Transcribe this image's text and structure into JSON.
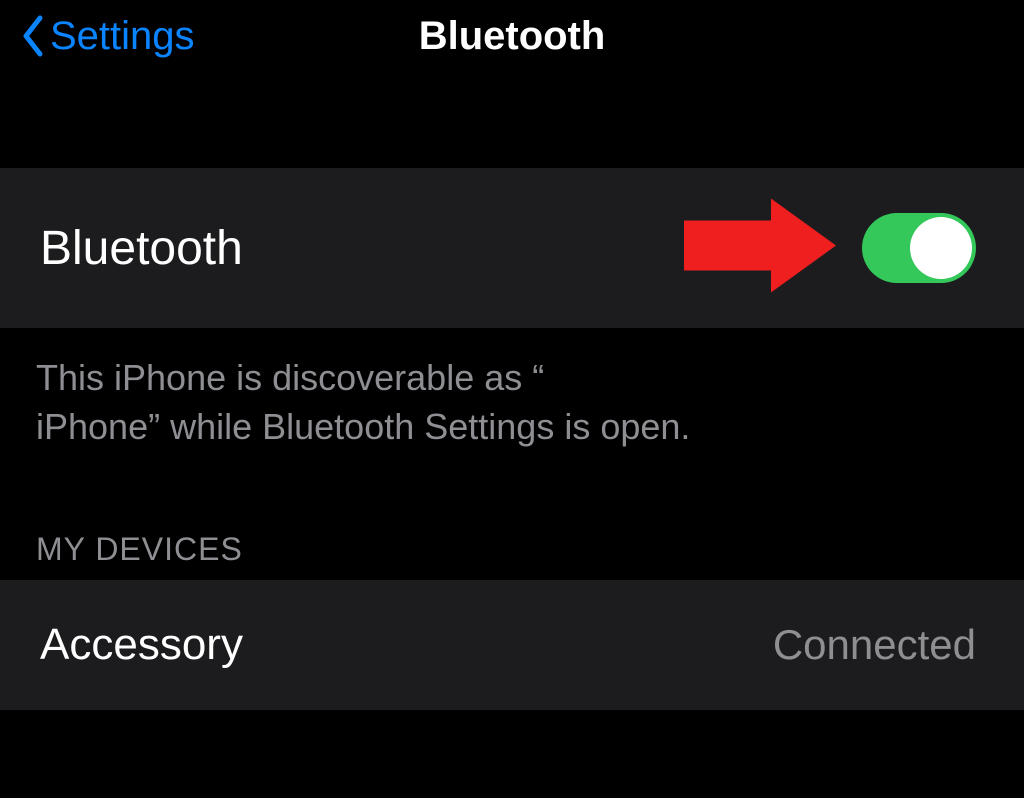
{
  "header": {
    "back_label": "Settings",
    "title": "Bluetooth"
  },
  "bluetooth": {
    "row_label": "Bluetooth",
    "toggle_on": true,
    "discoverable_text_line1": "This iPhone is discoverable as “",
    "discoverable_text_line2": "iPhone” while Bluetooth Settings is open."
  },
  "devices": {
    "section_header": "MY DEVICES",
    "items": [
      {
        "name": "Accessory",
        "status": "Connected"
      }
    ]
  },
  "annotation": {
    "arrow_color": "#ef1f1f"
  },
  "colors": {
    "ios_blue": "#0a84ff",
    "ios_green": "#34c759",
    "row_bg": "#1c1c1e",
    "muted_text": "#8e8e93"
  }
}
